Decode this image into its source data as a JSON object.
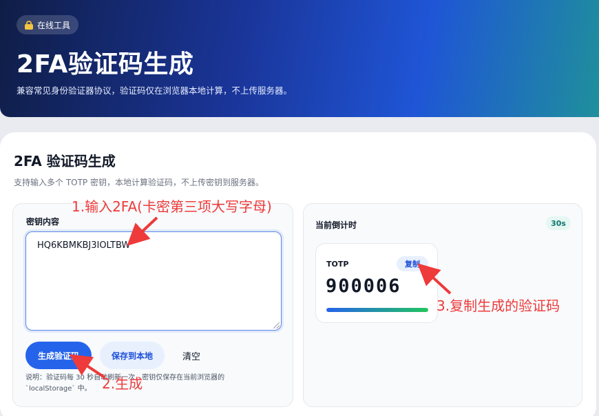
{
  "hero": {
    "badge": "在线工具",
    "title": "2FA验证码生成",
    "subtitle": "兼容常见身份验证器协议，验证码仅在浏览器本地计算，不上传服务器。"
  },
  "card": {
    "title": "2FA 验证码生成",
    "description": "支持输入多个 TOTP 密钥，本地计算验证码，不上传密钥到服务器。"
  },
  "input_panel": {
    "label": "密钥内容",
    "secret_value": "HQ6KBMKBJ3IOLTBW",
    "generate_label": "生成验证码",
    "save_label": "保存到本地",
    "clear_label": "清空",
    "note": "说明：验证码每 30 秒自动刷新一次，密钥仅保存在当前浏览器的 `localStorage` 中。"
  },
  "timer_panel": {
    "label": "当前倒计时",
    "badge": "30s",
    "totp": {
      "label": "TOTP",
      "copy_label": "复制",
      "code": "900006",
      "progress": 1.0
    }
  },
  "annotations": {
    "step1": "1.输入2FA(卡密第三项大写字母)",
    "step2": "2.生成",
    "step3": "3.复制生成的验证码"
  },
  "colors": {
    "accent": "#2563eb",
    "annotation": "#ee3a3a"
  }
}
